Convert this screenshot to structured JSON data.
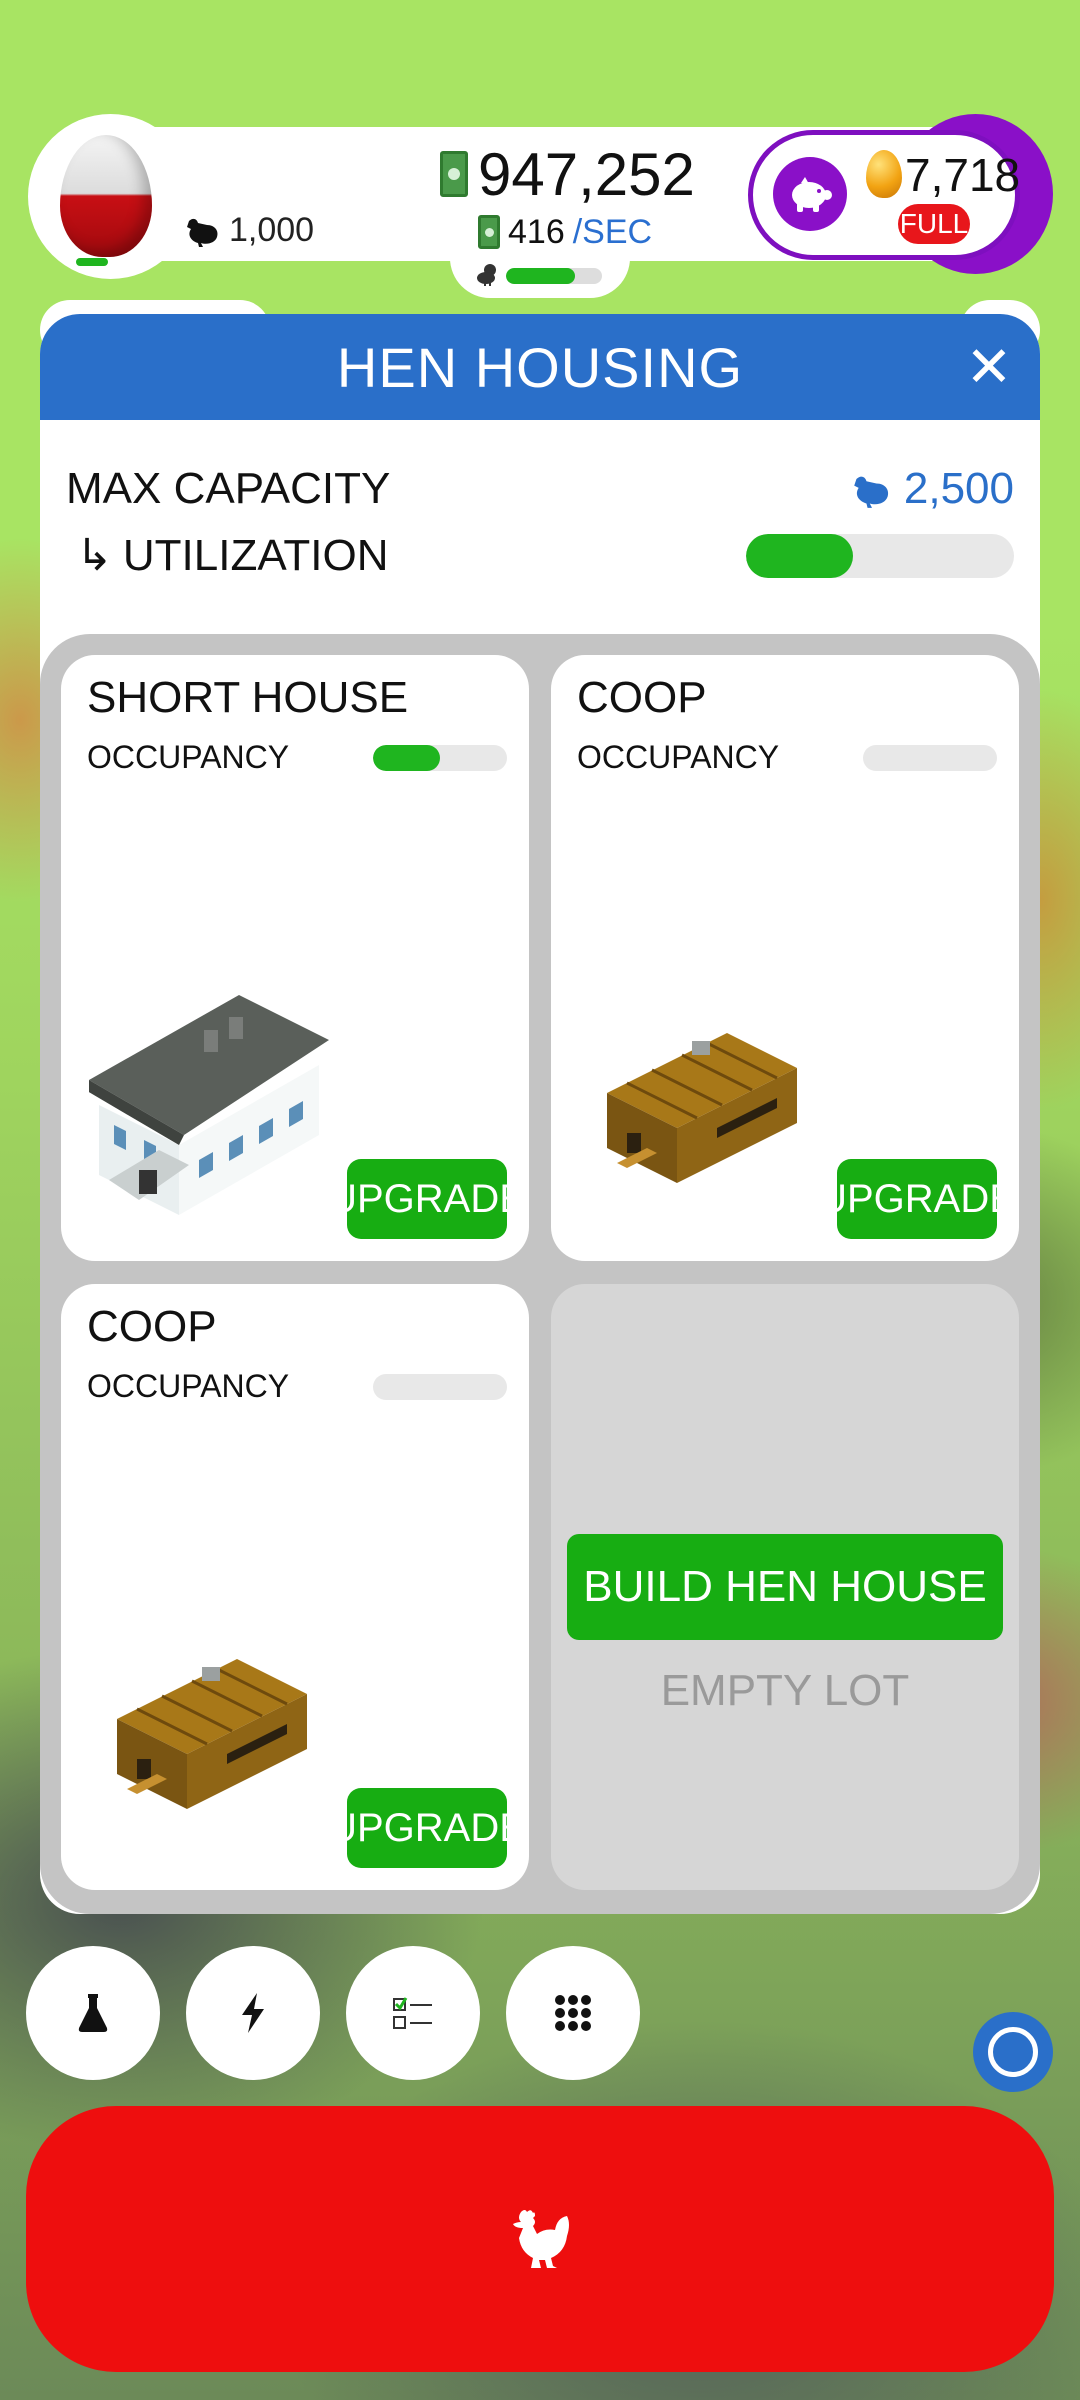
{
  "hud": {
    "hen_count": "1,000",
    "money": "947,252",
    "rate_value": "416",
    "rate_unit": "/SEC",
    "habitat_fill": 0.72,
    "golden_eggs": "7,718",
    "silo_status": "FULL"
  },
  "panel": {
    "title": "HEN HOUSING",
    "close_label": "✕",
    "max_capacity_label": "MAX CAPACITY",
    "max_capacity_value": "2,500",
    "utilization_label": "UTILIZATION",
    "utilization_fill": 0.4
  },
  "houses": [
    {
      "name": "SHORT HOUSE",
      "occupancy_label": "OCCUPANCY",
      "occupancy_fill": 0.5,
      "button": "UPGRADE",
      "type": "short-house"
    },
    {
      "name": "COOP",
      "occupancy_label": "OCCUPANCY",
      "occupancy_fill": 0,
      "button": "UPGRADE",
      "type": "coop"
    },
    {
      "name": "COOP",
      "occupancy_label": "OCCUPANCY",
      "occupancy_fill": 0,
      "button": "UPGRADE",
      "type": "coop"
    }
  ],
  "empty_slot": {
    "build_label": "BUILD HEN HOUSE",
    "empty_label": "EMPTY LOT"
  },
  "colors": {
    "accent_blue": "#2a6fc9",
    "green": "#17ad12",
    "red": "#ee0e0e",
    "purple": "#8a10c8"
  },
  "toolbar": {
    "items": [
      "research-flask-icon",
      "boost-lightning-icon",
      "missions-checklist-icon",
      "menu-grid-icon"
    ]
  }
}
